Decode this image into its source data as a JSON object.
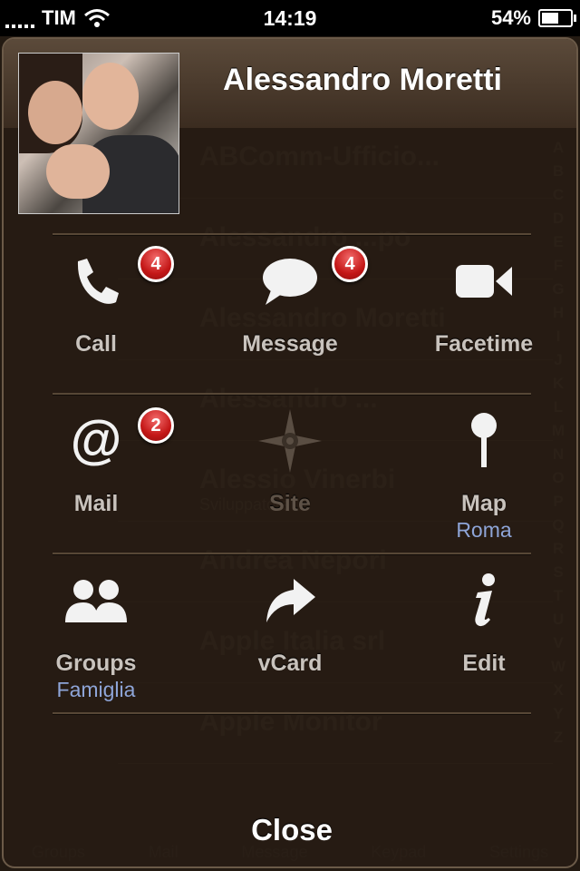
{
  "status_bar": {
    "carrier": "TIM",
    "time": "14:19",
    "battery": "54%",
    "battery_level": 0.54
  },
  "contact": {
    "name": "Alessandro Moretti"
  },
  "actions": {
    "call": {
      "label": "Call",
      "badge": "4",
      "icon": "phone-icon"
    },
    "message": {
      "label": "Message",
      "badge": "4",
      "icon": "speech-bubble-icon"
    },
    "facetime": {
      "label": "Facetime",
      "icon": "video-camera-icon"
    },
    "mail": {
      "label": "Mail",
      "badge": "2",
      "icon": "at-sign-icon"
    },
    "site": {
      "label": "Site",
      "icon": "compass-icon"
    },
    "map": {
      "label": "Map",
      "sublabel": "Roma",
      "icon": "map-pin-icon"
    },
    "groups": {
      "label": "Groups",
      "sublabel": "Famiglia",
      "icon": "groups-icon"
    },
    "vcard": {
      "label": "vCard",
      "icon": "share-arrow-icon"
    },
    "edit": {
      "label": "Edit",
      "icon": "info-icon"
    }
  },
  "close_label": "Close",
  "background": {
    "list": [
      {
        "name": "ABComm-Ufficio...",
        "sub": ""
      },
      {
        "name": "Alessandro ...po",
        "sub": ""
      },
      {
        "name": "Alessandro Moretti",
        "sub": ""
      },
      {
        "name": "Alessandro ...",
        "sub": ""
      },
      {
        "name": "Alessio Vinerbi",
        "sub": "Sviluppatore"
      },
      {
        "name": "Andrea Nepori",
        "sub": ""
      },
      {
        "name": "Apple Italia srl",
        "sub": ""
      },
      {
        "name": "Apple Monitor",
        "sub": ""
      }
    ],
    "index": [
      "A",
      "B",
      "C",
      "D",
      "E",
      "F",
      "G",
      "H",
      "I",
      "J",
      "K",
      "L",
      "M",
      "N",
      "O",
      "P",
      "Q",
      "R",
      "S",
      "T",
      "U",
      "V",
      "W",
      "X",
      "Y",
      "Z"
    ],
    "tabs": [
      "Groups",
      "Mail",
      "Message",
      "Keypad",
      "Settings"
    ]
  },
  "colors": {
    "badge": "#c41717",
    "sublabel": "#8ea5d8",
    "label": "#c9c3bd"
  }
}
